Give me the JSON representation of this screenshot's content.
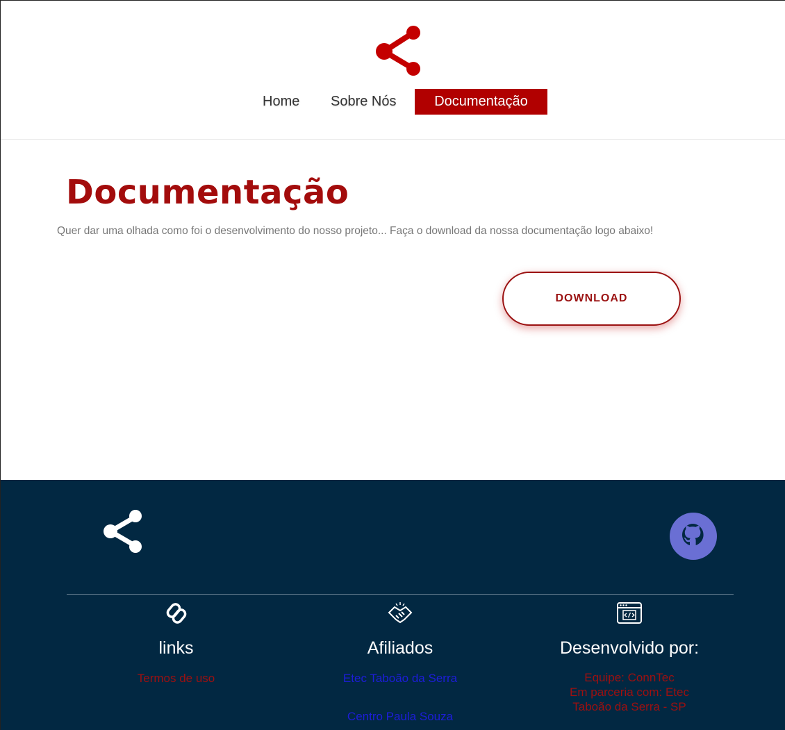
{
  "nav": {
    "items": [
      {
        "label": "Home"
      },
      {
        "label": "Sobre Nós"
      },
      {
        "label": "Documentação"
      }
    ],
    "active": "Documentação"
  },
  "main": {
    "title": "Documentação",
    "description": "Quer dar uma olhada como foi o desenvolvimento do nosso projeto... Faça o download da nossa documentação logo abaixo!",
    "download_label": "DOWNLOAD"
  },
  "footer": {
    "links": {
      "title": "links",
      "icon": "link-icon",
      "items": [
        "Termos de uso"
      ]
    },
    "afiliados": {
      "title": "Afiliados",
      "icon": "handshake-icon",
      "items": [
        "Etec Taboão da Serra",
        "Centro Paula Souza"
      ]
    },
    "desenvolvido": {
      "title": "Desenvolvido por:",
      "icon": "code-window-icon",
      "lines": [
        "Equipe: ConnTec",
        "Em parceria com: Etec",
        "Taboão da Serra - SP"
      ]
    }
  },
  "colors": {
    "brand_red": "#b10000",
    "footer_bg": "#022842",
    "github_purple": "#6a6fd4",
    "link_blue": "#1d1dd8"
  }
}
